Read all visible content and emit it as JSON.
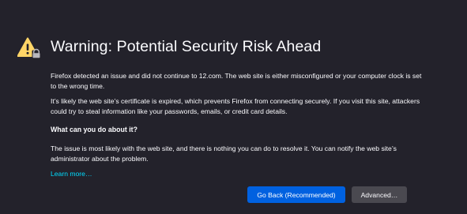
{
  "icons": {
    "warning": "warning-triangle-icon",
    "lock": "lock-icon"
  },
  "colors": {
    "background": "#23222b",
    "text": "#fbfbfe",
    "warning_yellow": "#ffd567",
    "link": "#00ddff",
    "primary_button": "#0061e0",
    "secondary_button": "#4a4950"
  },
  "page": {
    "title": "Warning: Potential Security Risk Ahead",
    "paragraph1": "Firefox detected an issue and did not continue to 12.com. The web site is either misconfigured or your computer clock is set to the wrong time.",
    "paragraph2": "It’s likely the web site’s certificate is expired, which prevents Firefox from connecting securely. If you visit this site, attackers could try to steal information like your passwords, emails, or credit card details.",
    "subheading": "What can you do about it?",
    "paragraph3": "The issue is most likely with the web site, and there is nothing you can do to resolve it. You can notify the web site’s administrator about the problem.",
    "learn_more": "Learn more…"
  },
  "buttons": {
    "go_back": "Go Back (Recommended)",
    "advanced": "Advanced…"
  }
}
